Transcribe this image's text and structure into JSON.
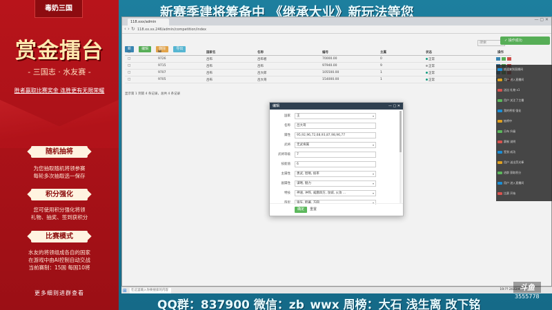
{
  "left": {
    "brand": "毒奶三国",
    "title": "赏金擂台",
    "subtitle": "- 三国志 · 水友赛 -",
    "note": "胜者赢取比赛奖金 连胜更有无限荣耀",
    "sections": [
      {
        "heading": "随机抽将",
        "lines": [
          "为您抽取随机将领参赛",
          "每轮多次抽取选一保存"
        ]
      },
      {
        "heading": "积分强化",
        "lines": [
          "您可使用积分强化将领",
          "礼物、抽奖、签到获积分"
        ]
      },
      {
        "heading": "比赛模式",
        "lines": [
          "水友的将领组成各自的国家",
          "在游戏中由AI控制自动交战",
          "当前赛制：15国 每国10将"
        ]
      }
    ],
    "more": "更多细则进群查看"
  },
  "banner": "新赛季建将筹备中 《继承大业》新玩法等您",
  "browser": {
    "tab_title": "118.xxx/admin",
    "address": "118.xx.xx.246/admin/competition/index",
    "toolbar": [
      {
        "label": "新",
        "color": "#3c8dbc"
      },
      {
        "label": "编辑",
        "color": "#5cb85c"
      },
      {
        "label": "删除",
        "color": "#f0ad4e"
      },
      {
        "label": "导出",
        "color": "#5bc0de"
      }
    ],
    "search_placeholder": "搜索",
    "toast": "操作成功",
    "table": {
      "headers": [
        "Id",
        "国家名",
        "名称",
        "编号",
        "主属",
        "状态",
        "操作"
      ],
      "rows": [
        {
          "id": "9726",
          "owner": "吕布",
          "name": "吕布者",
          "no": "70000.00",
          "v": "0",
          "status": "正常",
          "color": "#18a689"
        },
        {
          "id": "9715",
          "owner": "吕布",
          "name": "吕布",
          "no": "97940.00",
          "v": "9",
          "status": "正常",
          "color": "#aaaaaa"
        },
        {
          "id": "9707",
          "owner": "吕布",
          "name": "吕大郎",
          "no": "105500.00",
          "v": "1",
          "status": "正常",
          "color": "#18a689"
        },
        {
          "id": "9705",
          "owner": "吕布",
          "name": "吕大哥",
          "no": "154000.00",
          "v": "1",
          "status": "正常",
          "color": "#18a689"
        }
      ],
      "footer": "显示第 1 到第 4 条记录，总共 4 条记录"
    },
    "modal": {
      "title": "编辑",
      "fields": [
        {
          "label": "国家",
          "value": "王",
          "select": true
        },
        {
          "label": "名称",
          "value": "吕大哥",
          "select": false
        },
        {
          "label": "属性",
          "value": "95,92,96,72,68,93,87,98,96,77",
          "select": false
        },
        {
          "label": "武将",
          "value": "无武将属",
          "select": true
        },
        {
          "label": "武将等级",
          "value": "7",
          "select": false
        },
        {
          "label": "技能值",
          "value": "6",
          "select": false
        },
        {
          "label": "主属性",
          "value": "勇武, 智略, 统率",
          "select": true
        },
        {
          "label": "副属性",
          "value": "谋略, 魅力",
          "select": true
        },
        {
          "label": "特技",
          "value": "神速, 冲阵, 威震四方, 攻城, 火攻 ...",
          "select": true
        },
        {
          "label": "阵型",
          "value": "锋矢, 鹤翼, 方圆",
          "select": true
        }
      ],
      "ok": "确定",
      "cancel": "重置"
    },
    "taskbar_search": "在这里输入你要搜索的内容",
    "taskbar_time": "19:?? 2022/4/??"
  },
  "chat_lines": [
    "欢迎来到直播间",
    "用户 进入直播间",
    "送出 礼物 x1",
    "用户 关注了主播",
    "我的将领 强化",
    "抽将中",
    "吕布 升级",
    "赛制 说明",
    "签到 成功",
    "用户 送出荧光棒",
    "进群 获取积分",
    "用户 进入直播间",
    "比赛 开始"
  ],
  "bottom": "QQ群：837900 微信：zb_wwx 周榜：大石 浅生离 改下铭",
  "logo": "斗鱼",
  "room_id": "3555778"
}
